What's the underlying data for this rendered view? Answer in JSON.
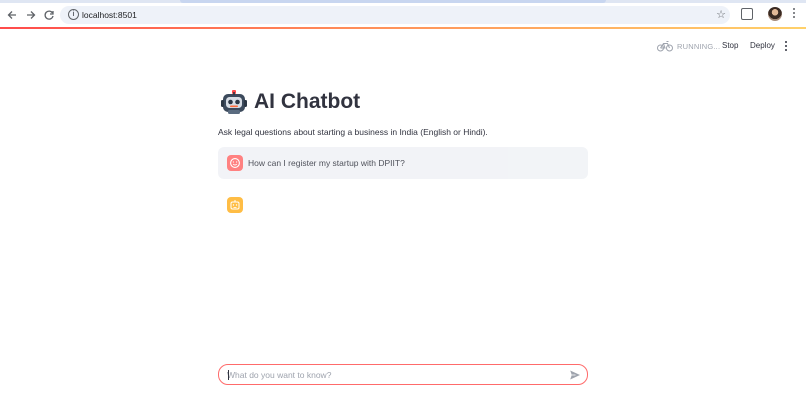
{
  "browser": {
    "url": "localhost:8501",
    "icons": [
      "back-arrow-icon",
      "forward-arrow-icon",
      "reload-icon",
      "site-info-icon",
      "bookmark-star-icon",
      "extensions-icon",
      "profile-avatar",
      "browser-menu-icon"
    ]
  },
  "header": {
    "running_label": "RUNNING...",
    "stop_label": "Stop",
    "deploy_label": "Deploy"
  },
  "main": {
    "title": "AI Chatbot",
    "subtitle": "Ask legal questions about starting a business in India (English or Hindi).",
    "messages": [
      {
        "role": "user",
        "text": "How can I register my startup with DPIIT?"
      },
      {
        "role": "assistant",
        "text": ""
      }
    ]
  },
  "chat_input": {
    "placeholder": "What do you want to know?",
    "value": ""
  },
  "colors": {
    "accent": "#ff4b4b",
    "user_avatar": "#ff6c6c",
    "assistant_avatar": "#ffbd45",
    "text": "#31333f",
    "message_bg": "#f0f2f6"
  }
}
